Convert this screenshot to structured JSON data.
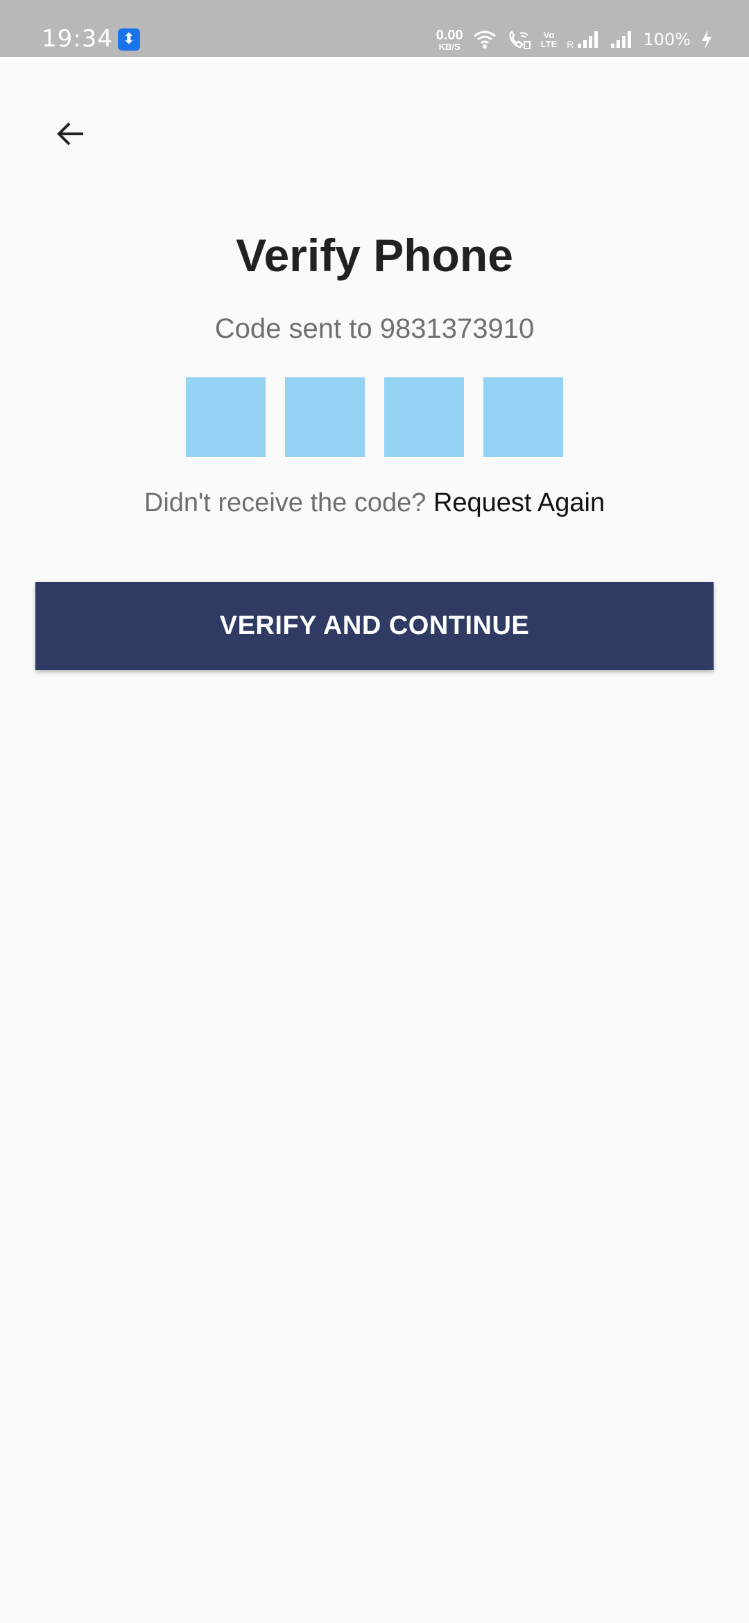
{
  "status_bar": {
    "time": "19:34",
    "usb_icon": "usb-icon",
    "net_speed_value": "0.00",
    "net_speed_unit": "KB/S",
    "volte_top": "Vo",
    "volte_bottom": "LTE",
    "roaming_label": "R",
    "battery": "100%",
    "icons": [
      "wifi-icon",
      "wifi-calling-icon",
      "volte-icon",
      "signal-icon",
      "signal-icon",
      "charging-icon"
    ]
  },
  "header": {
    "back_icon": "arrow-back-icon"
  },
  "main": {
    "title": "Verify Phone",
    "subtitle": "Code sent to 9831373910",
    "code_boxes": [
      "",
      "",
      "",
      ""
    ],
    "resend_prompt": "Didn't receive the code?",
    "resend_link": "Request Again",
    "verify_button_label": "VERIFY AND CONTINUE"
  },
  "colors": {
    "background": "#fafafa",
    "status_bar": "#b8b8b8",
    "code_box": "#95d3f4",
    "primary_button": "#2f3b63",
    "title_text": "#212121",
    "secondary_text": "#6f6f6f"
  }
}
